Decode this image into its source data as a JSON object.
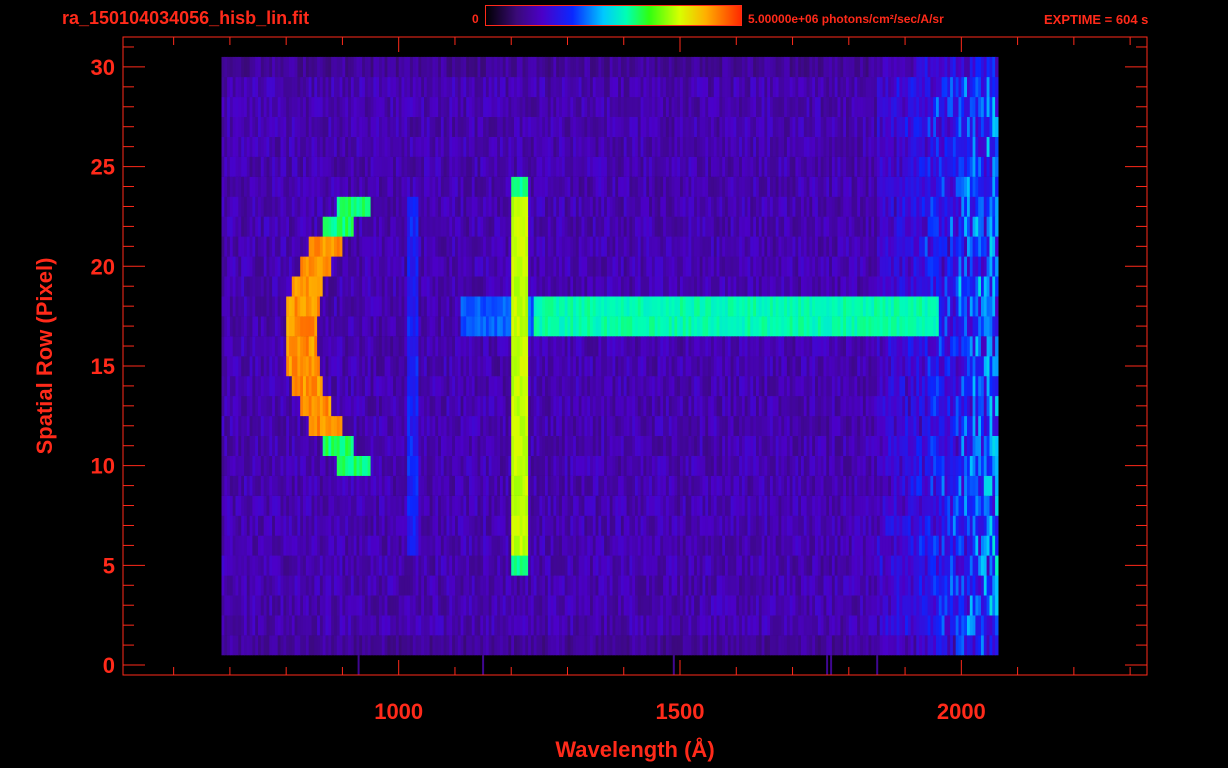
{
  "header": {
    "file_title": "ra_150104034056_hisb_lin.fit",
    "colorbar_min": "0",
    "colorbar_max": "5.00000e+06 photons/cm²/sec/A/sr",
    "exptime": "EXPTIME = 604 s"
  },
  "colors": {
    "text": "#ff2a1a",
    "axes": "#ff2a1a",
    "background": "#000000"
  },
  "chart_data": {
    "type": "heatmap",
    "colormap": "rainbow",
    "xlabel": "Wavelength (Å)",
    "ylabel": "Spatial Row (Pixel)",
    "xlim": [
      510,
      2330
    ],
    "ylim": [
      -0.5,
      31.5
    ],
    "x_ticks": [
      {
        "value": 1000,
        "label": "1000"
      },
      {
        "value": 1500,
        "label": "1500"
      },
      {
        "value": 2000,
        "label": "2000"
      }
    ],
    "y_ticks": [
      {
        "value": 0,
        "label": "0"
      },
      {
        "value": 5,
        "label": "5"
      },
      {
        "value": 10,
        "label": "10"
      },
      {
        "value": 15,
        "label": "15"
      },
      {
        "value": 20,
        "label": "20"
      },
      {
        "value": 25,
        "label": "25"
      },
      {
        "value": 30,
        "label": "30"
      }
    ],
    "x_minor_step": 100,
    "y_minor_step": 1,
    "data_extent": {
      "x": [
        685,
        2065
      ],
      "rows": [
        1,
        30
      ]
    },
    "features": [
      {
        "name": "arc",
        "x_outer": 800,
        "x_inner": 850,
        "center_row": 16.5,
        "half_height": 6.5,
        "peak_rows": [
          13,
          20
        ],
        "intensity": 0.85
      },
      {
        "name": "line",
        "x": 1216,
        "rows": [
          5,
          24
        ],
        "intensity": 0.72
      },
      {
        "name": "band",
        "x_range": [
          1110,
          1960
        ],
        "rows": [
          17,
          18
        ],
        "intensity": 0.52
      },
      {
        "name": "faint-line",
        "x": 1026,
        "rows": [
          6,
          23
        ],
        "intensity": 0.28
      }
    ]
  }
}
